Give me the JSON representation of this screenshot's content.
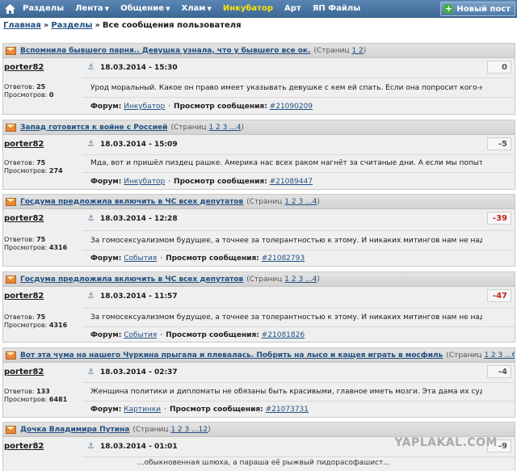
{
  "nav": {
    "items": [
      {
        "label": "Разделы",
        "caret": false
      },
      {
        "label": "Лента",
        "caret": true
      },
      {
        "label": "Общение",
        "caret": true
      },
      {
        "label": "Хлам",
        "caret": true
      },
      {
        "label": "Инкубатор",
        "caret": false,
        "active": true
      },
      {
        "label": "Арт",
        "caret": false
      },
      {
        "label": "ЯП Файлы",
        "caret": false
      }
    ],
    "new_post": "Новый пост"
  },
  "breadcrumb": {
    "home": "Главная",
    "sections": "Разделы",
    "current": "Все сообщения пользователя",
    "sep": "»"
  },
  "labels": {
    "replies": "Ответов:",
    "views": "Просмотров:",
    "forum": "Форум:",
    "view_msg": "Просмотр сообщения:",
    "pages_prefix": "(Страниц"
  },
  "posts": [
    {
      "title": "Вспомнила бывшего парня.. Девушка узнала, что у бывшего все ок.",
      "pages": "1 2",
      "author": "porter82",
      "date": "18.03.2014 - 15:30",
      "score": "0",
      "replies": "25",
      "views": "0",
      "excerpt": "Урод моральный. Какое он право имеет указывать девушке с кем ей спать. Если она попросит кого-нибудь...",
      "forum": "Инкубатор",
      "msg": "#21090209"
    },
    {
      "title": "Запад готовится к войне с Россией",
      "pages": "1 2 3 ...4",
      "author": "porter82",
      "date": "18.03.2014 - 15:09",
      "score": "-5",
      "replies": "75",
      "views": "274",
      "excerpt": "Мда, вот и пришёл пиздец рашке. Америка нас всех раком нагнёт за считаные дни. А если мы попытаемся ...",
      "forum": "Инкубатор",
      "msg": "#21089447"
    },
    {
      "title": "Госдума предложила включить в ЧС всех депутатов",
      "pages": "1 2 3 ...4",
      "author": "porter82",
      "date": "18.03.2014 - 12:28",
      "score": "-39",
      "replies": "75",
      "views": "4316",
      "excerpt": "За гомосексуализмом будущее, а точнее за толерантностью к этому. И никаких митингов нам не надо. Мы ...",
      "forum": "События",
      "msg": "#21082793"
    },
    {
      "title": "Госдума предложила включить в ЧС всех депутатов",
      "pages": "1 2 3 ...4",
      "author": "porter82",
      "date": "18.03.2014 - 11:57",
      "score": "-47",
      "replies": "75",
      "views": "4316",
      "excerpt": "За гомосексуализмом будущее, а точнее за толерантностью к этому. И никаких митингов нам не надо. Мы ...",
      "forum": "События",
      "msg": "#21081826"
    },
    {
      "title": "Вот эта чума на нашего Чуркина прыгала и плевалась. Побрить на лысо и кащея играть в мосфиль",
      "pages": "1 2 3 ...6",
      "author": "porter82",
      "date": "18.03.2014 - 02:37",
      "score": "-4",
      "replies": "133",
      "views": "6481",
      "excerpt": "Женщина политики и дипломаты не обязаны быть красивыми, главное иметь мозги. Эта дама их судя по все...",
      "forum": "Картинки",
      "msg": "#21073731"
    },
    {
      "title": "Дочка Владимира Путина",
      "pages": "1 2 3 ...12",
      "author": "porter82",
      "date": "18.03.2014 - 01:01",
      "score": "-9",
      "replies": "",
      "views": "",
      "excerpt": "",
      "forum": "",
      "msg": ""
    }
  ],
  "partial_text": "...обыкновенная шлюха, а параша её рыжвый пидорасофашист...",
  "watermark": "YAPLAKAL.COM",
  "colors": {
    "nav_bg": "#4a76a4",
    "active_nav": "#ffe400",
    "link": "#1f4f82",
    "negative": "#c4211e",
    "new_post_plus": "#3fae3a"
  }
}
